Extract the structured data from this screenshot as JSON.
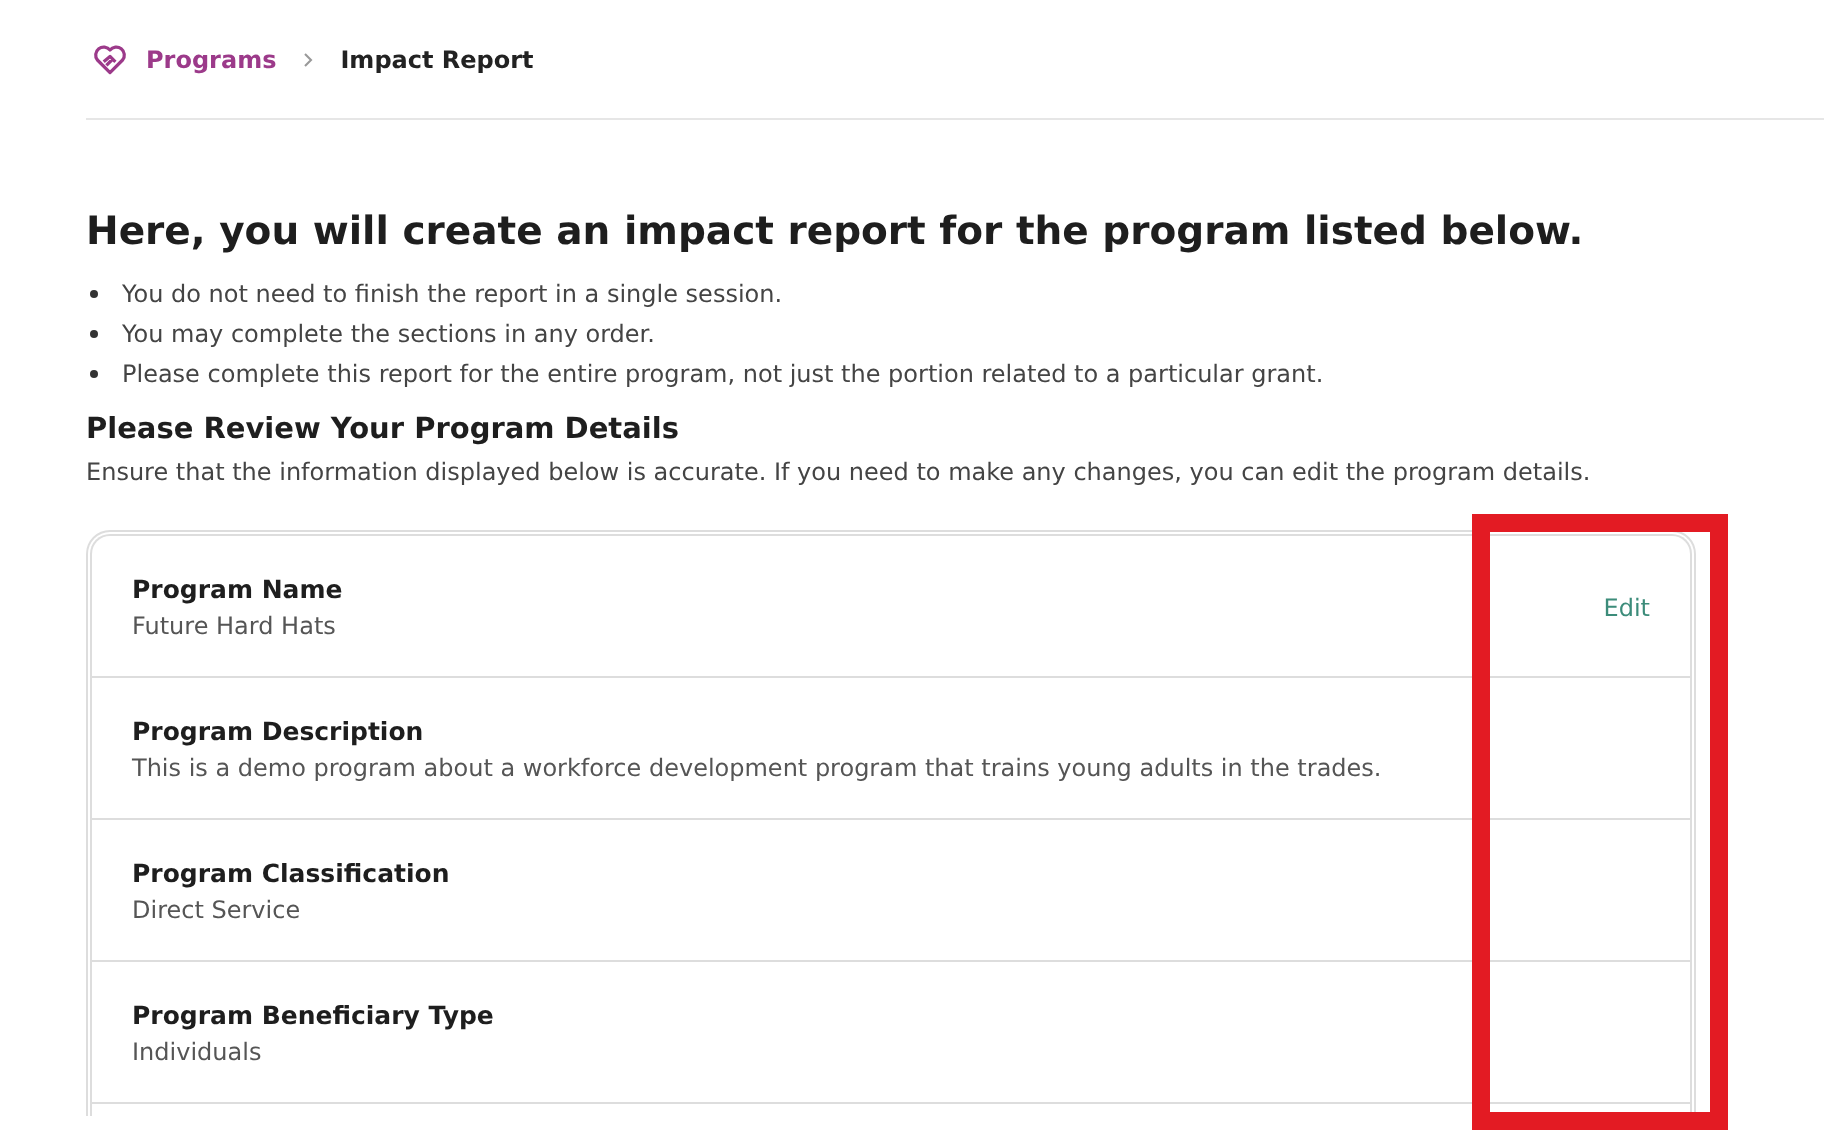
{
  "breadcrumb": {
    "items": [
      {
        "label": "Programs",
        "kind": "link"
      },
      {
        "label": "Impact Report",
        "kind": "current"
      }
    ]
  },
  "title": "Here, you will create an impact report for the program listed below.",
  "notes": [
    "You do not need to finish the report in a single session.",
    "You may complete the sections in any order.",
    "Please complete this report for the entire program, not just the portion related to a particular grant."
  ],
  "review": {
    "heading": "Please Review Your Program Details",
    "description": "Ensure that the information displayed below is accurate. If you need to make any changes, you can edit the program details.",
    "highlight_actions": true,
    "fields": [
      {
        "label": "Program Name",
        "value": "Future Hard Hats",
        "action": "Edit"
      },
      {
        "label": "Program Description",
        "value": "This is a demo program about a workforce development program that trains young adults in the trades."
      },
      {
        "label": "Program Classification",
        "value": "Direct Service"
      },
      {
        "label": "Program Beneficiary Type",
        "value": "Individuals"
      }
    ]
  }
}
